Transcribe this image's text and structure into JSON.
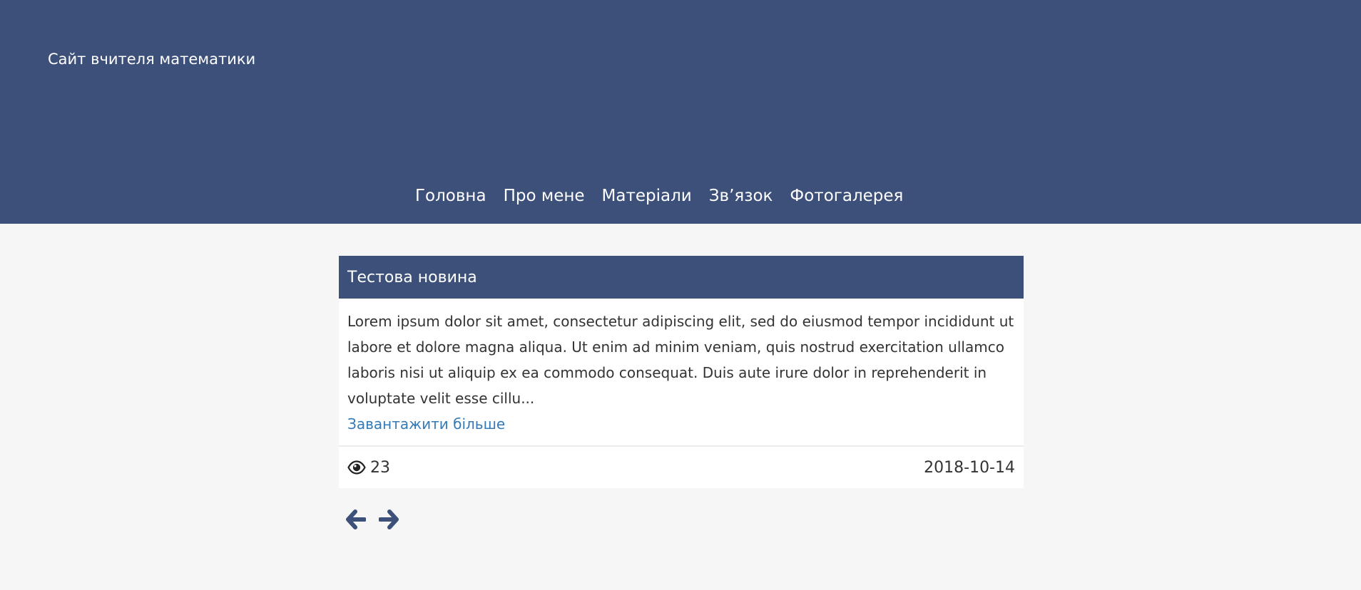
{
  "header": {
    "site_title": "Сайт вчителя математики",
    "nav": [
      {
        "label": "Головна"
      },
      {
        "label": "Про мене"
      },
      {
        "label": "Матеріали"
      },
      {
        "label": "Зв’язок"
      },
      {
        "label": "Фотогалерея"
      }
    ]
  },
  "news": {
    "title": "Тестова новина",
    "text": "Lorem ipsum dolor sit amet, consectetur adipiscing elit, sed do eiusmod tempor incididunt ut labore et dolore magna aliqua. Ut enim ad minim veniam, quis nostrud exercitation ullamco laboris nisi ut aliquip ex ea commodo consequat. Duis aute irure dolor in reprehenderit in voluptate velit esse cillu...",
    "load_more": "Завантажити більше",
    "views": "23",
    "views_icon": "eye-icon",
    "date": "2018-10-14"
  },
  "pager": {
    "prev_icon": "arrow-left-icon",
    "next_icon": "arrow-right-icon"
  },
  "colors": {
    "primary": "#3c5079",
    "background": "#f6f6f6",
    "link": "#337ab7",
    "text": "#333333"
  }
}
